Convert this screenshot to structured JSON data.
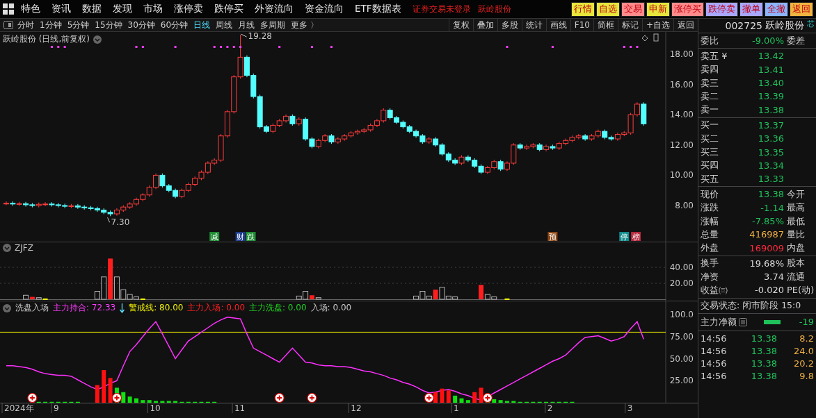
{
  "menu": {
    "items": [
      "特色",
      "资讯",
      "数据",
      "发现",
      "市场",
      "涨停卖",
      "跌停买",
      "外资流向",
      "资金流向",
      "ETF数据表"
    ],
    "notices": [
      "证券交易未登录",
      "跃岭股份"
    ],
    "quick_buttons": [
      {
        "label": "行情",
        "color": "#e6e63c"
      },
      {
        "label": "自选",
        "color": "#e6e63c"
      },
      {
        "label": "交易",
        "color": "#ff8c8c"
      },
      {
        "label": "申新",
        "color": "#e6e63c"
      },
      {
        "label": "涨停买",
        "color": "#ff8c8c"
      },
      {
        "label": "跌停卖",
        "color": "#a8a8ff"
      },
      {
        "label": "撤单",
        "color": "#a8a8ff"
      },
      {
        "label": "全撤",
        "color": "#8cb4ff"
      },
      {
        "label": "返回",
        "color": "#f0b440"
      }
    ]
  },
  "periods": [
    {
      "label": "分时",
      "selected": false
    },
    {
      "label": "1分钟",
      "selected": false
    },
    {
      "label": "5分钟",
      "selected": false
    },
    {
      "label": "15分钟",
      "selected": false
    },
    {
      "label": "30分钟",
      "selected": false
    },
    {
      "label": "60分钟",
      "selected": false
    },
    {
      "label": "日线",
      "selected": true
    },
    {
      "label": "周线",
      "selected": false
    },
    {
      "label": "月线",
      "selected": false
    },
    {
      "label": "多周期",
      "selected": false
    },
    {
      "label": "更多 〉",
      "selected": false
    }
  ],
  "tools": [
    "复权",
    "叠加",
    "多股",
    "统计",
    "画线",
    "F10",
    "简框",
    "标记",
    "+自选",
    "返回"
  ],
  "price_pane": {
    "title": "跃岭股份 (日线,前复权)",
    "axis_labels": [
      "18.00",
      "16.00",
      "14.00",
      "12.00",
      "10.00",
      "8.00"
    ],
    "high_label": "19.28",
    "low_label": "7.30",
    "tags": [
      {
        "label": "减",
        "color": "#1e8c32"
      },
      {
        "label": "财",
        "color": "#1e3c8c"
      },
      {
        "label": "跌",
        "color": "#1e8c32"
      },
      {
        "label": "预",
        "color": "#8c4614"
      },
      {
        "label": "停",
        "color": "#148c8c"
      },
      {
        "label": "榜",
        "color": "#b4283c"
      }
    ]
  },
  "zjfz_pane": {
    "title": "ZJFZ",
    "axis_labels": [
      "40.00",
      "20.00"
    ]
  },
  "wash_pane": {
    "title": "洗盘入场",
    "legend": [
      {
        "text": "主力持合: 72.33",
        "color": "#ff3cff",
        "arrow": true
      },
      {
        "text": "警戒线: 80.00",
        "color": "#f0f000",
        "arrow": false
      },
      {
        "text": "主力入场: 0.00",
        "color": "#ff2020",
        "arrow": false
      },
      {
        "text": "主力洗盘: 0.00",
        "color": "#20d020",
        "arrow": false
      },
      {
        "text": "入场: 0.00",
        "color": "#c8c8c8",
        "arrow": false
      }
    ],
    "axis_labels": [
      "100.0",
      "75.00",
      "50.00",
      "25.00"
    ],
    "date_labels": [
      "2024年",
      "9",
      "10",
      "11",
      "12",
      "1",
      "2",
      "3"
    ]
  },
  "quote": {
    "code": "002725",
    "name": "跃岭股份",
    "badge": "芯",
    "sections": [
      [
        {
          "label": "委比",
          "value": "-9.00%",
          "color": "#1fc15a",
          "label2": "委差"
        }
      ],
      [
        {
          "label": "卖五 ¥",
          "value": "13.42",
          "color": "#1fc15a"
        },
        {
          "label": "卖四",
          "value": "13.41",
          "color": "#1fc15a"
        },
        {
          "label": "卖三",
          "value": "13.40",
          "color": "#1fc15a"
        },
        {
          "label": "卖二",
          "value": "13.39",
          "color": "#1fc15a"
        },
        {
          "label": "卖一",
          "value": "13.38",
          "color": "#1fc15a"
        }
      ],
      [
        {
          "label": "买一",
          "value": "13.37",
          "color": "#1fc15a"
        },
        {
          "label": "买二",
          "value": "13.36",
          "color": "#1fc15a"
        },
        {
          "label": "买三",
          "value": "13.35",
          "color": "#1fc15a"
        },
        {
          "label": "买四",
          "value": "13.34",
          "color": "#1fc15a"
        },
        {
          "label": "买五",
          "value": "13.33",
          "color": "#1fc15a"
        }
      ],
      [
        {
          "label": "现价",
          "value": "13.38",
          "color": "#1fc15a",
          "label2": "今开"
        },
        {
          "label": "涨跌",
          "value": "-1.14",
          "color": "#1fc15a",
          "label2": "最高"
        },
        {
          "label": "涨幅",
          "value": "-7.85%",
          "color": "#1fc15a",
          "label2": "最低"
        },
        {
          "label": "总量",
          "value": "416987",
          "color": "#f0b040",
          "label2": "量比"
        },
        {
          "label": "外盘",
          "value": "169009",
          "color": "#ff2b3c",
          "label2": "内盘"
        }
      ],
      [
        {
          "label": "换手",
          "value": "19.68%",
          "color": "#dcdcdc",
          "label2": "股本"
        },
        {
          "label": "净资",
          "value": "3.74",
          "color": "#dcdcdc",
          "label2": "流通"
        },
        {
          "label": "收益㈢",
          "value": "-0.020",
          "color": "#dcdcdc",
          "label2": "PE(动)"
        }
      ]
    ],
    "status": "交易状态: 闭市阶段 15:0",
    "net": {
      "label": "主力净额",
      "value": "-19"
    },
    "ticks": [
      {
        "time": "14:56",
        "price": "13.38",
        "volume": "8.2"
      },
      {
        "time": "14:56",
        "price": "13.38",
        "volume": "24.0"
      },
      {
        "time": "14:56",
        "price": "13.38",
        "volume": "20.2"
      },
      {
        "time": "14:56",
        "price": "13.38",
        "volume": "9.8"
      }
    ]
  }
}
